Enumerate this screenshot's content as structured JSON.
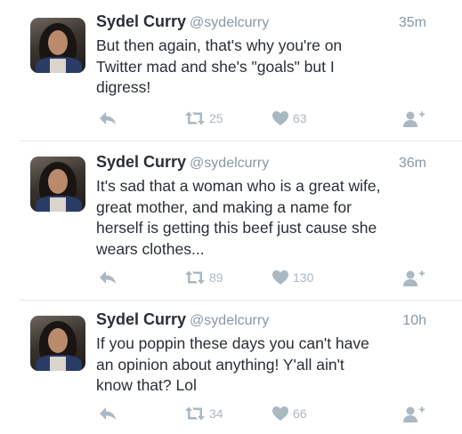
{
  "tweets": [
    {
      "name": "Sydel Curry",
      "handle": "@sydelcurry",
      "time": "35m",
      "lines": [
        "But then again, that's why you're on",
        "Twitter mad and she's \"goals\" but I",
        "digress!"
      ],
      "retweets": "25",
      "likes": "63"
    },
    {
      "name": "Sydel Curry",
      "handle": "@sydelcurry",
      "time": "36m",
      "lines": [
        "It's sad that a woman who is a great wife,",
        "great mother, and making a name for",
        "herself is getting this beef just cause she",
        "wears clothes..."
      ],
      "retweets": "89",
      "likes": "130"
    },
    {
      "name": "Sydel Curry",
      "handle": "@sydelcurry",
      "time": "10h",
      "lines": [
        "If you poppin these days you can't have",
        "an opinion about anything! Y'all ain't",
        "know that? Lol"
      ],
      "retweets": "34",
      "likes": "66"
    }
  ],
  "icons": {
    "reply": "reply-icon",
    "retweet": "retweet-icon",
    "like": "heart-icon",
    "follow": "follow-icon"
  },
  "colors": {
    "icon": "#aab8c2",
    "name": "#292f33",
    "muted": "#8899a6",
    "divider": "#e1e8ed"
  }
}
